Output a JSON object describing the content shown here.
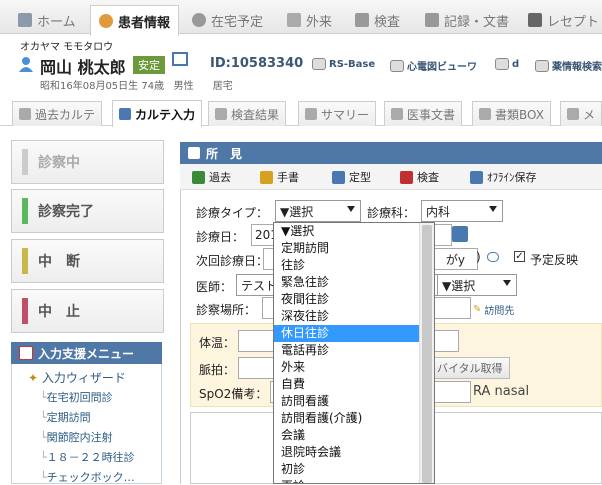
{
  "top_nav": {
    "tabs": [
      {
        "label": "ホーム",
        "icon": "home-icon"
      },
      {
        "label": "患者情報",
        "icon": "user-icon"
      },
      {
        "label": "在宅予定",
        "icon": "clock-icon"
      },
      {
        "label": "外来",
        "icon": "person-icon"
      },
      {
        "label": "検査",
        "icon": "chart-icon"
      },
      {
        "label": "記録・文書",
        "icon": "document-icon"
      },
      {
        "label": "レセプト",
        "icon": "receipt-icon"
      }
    ]
  },
  "patient": {
    "kana": "オカヤマ モモタロウ",
    "name": "岡山 桃太郎",
    "badge": "安定",
    "id": "ID:10583340",
    "birth": "昭和16年08月05日生 74歳",
    "sex": "男性",
    "residence": "居宅"
  },
  "ext_links": [
    "RS-Base",
    "心電図ビューワ",
    "d",
    "薬情報検索"
  ],
  "sub_tabs": [
    "過去カルテ",
    "カルテ入力",
    "検査結果",
    "サマリー",
    "医事文書",
    "書類BOX",
    "メ"
  ],
  "status_buttons": [
    {
      "label": "診察中",
      "color": "#cccccc"
    },
    {
      "label": "診察完了",
      "color": "#5cb85c"
    },
    {
      "label": "中　断",
      "color": "#c8b84a"
    },
    {
      "label": "中　止",
      "color": "#c0506a"
    }
  ],
  "support_menu": {
    "title": "入力支援メニュー",
    "items": [
      "入力ウィザード",
      "在宅初回問診",
      "定期訪問",
      "関節腔内注射",
      "１８－２２時往診",
      "チェックボック…"
    ]
  },
  "findings": {
    "title": "所　見",
    "toolbar": [
      "過去",
      "手書",
      "定型",
      "検査",
      "ｵﾌﾗｲﾝ保存"
    ],
    "labels": {
      "type": "診療タイプ：",
      "dept": "診療科：",
      "date": "診療日：",
      "next": "次回診療日：",
      "doctor": "医師：",
      "place": "診察場所："
    },
    "type_value": "▼選択",
    "dept_value": "内科",
    "date_value": "201",
    "next_value": "",
    "doctor_value": "テスト",
    "second_select": "▼選択",
    "next_select_suffix": "がy",
    "reflect_label": "予定反映",
    "visit_link": "訪問先",
    "vitals": {
      "temp_label": "体温：",
      "pulse_label": "脈拍：",
      "spo2_label": "SpO2備考：",
      "vital_button": "バイタル取得",
      "ra": "RA nasal"
    }
  },
  "dropdown": {
    "options": [
      "▼選択",
      "定期訪問",
      "往診",
      "緊急往診",
      "夜間往診",
      "深夜往診",
      "休日往診",
      "電話再診",
      "外来",
      "自費",
      "訪問看護",
      "訪問看護(介護)",
      "会議",
      "退院時会議",
      "初診",
      "再診"
    ],
    "highlighted_index": 6
  }
}
